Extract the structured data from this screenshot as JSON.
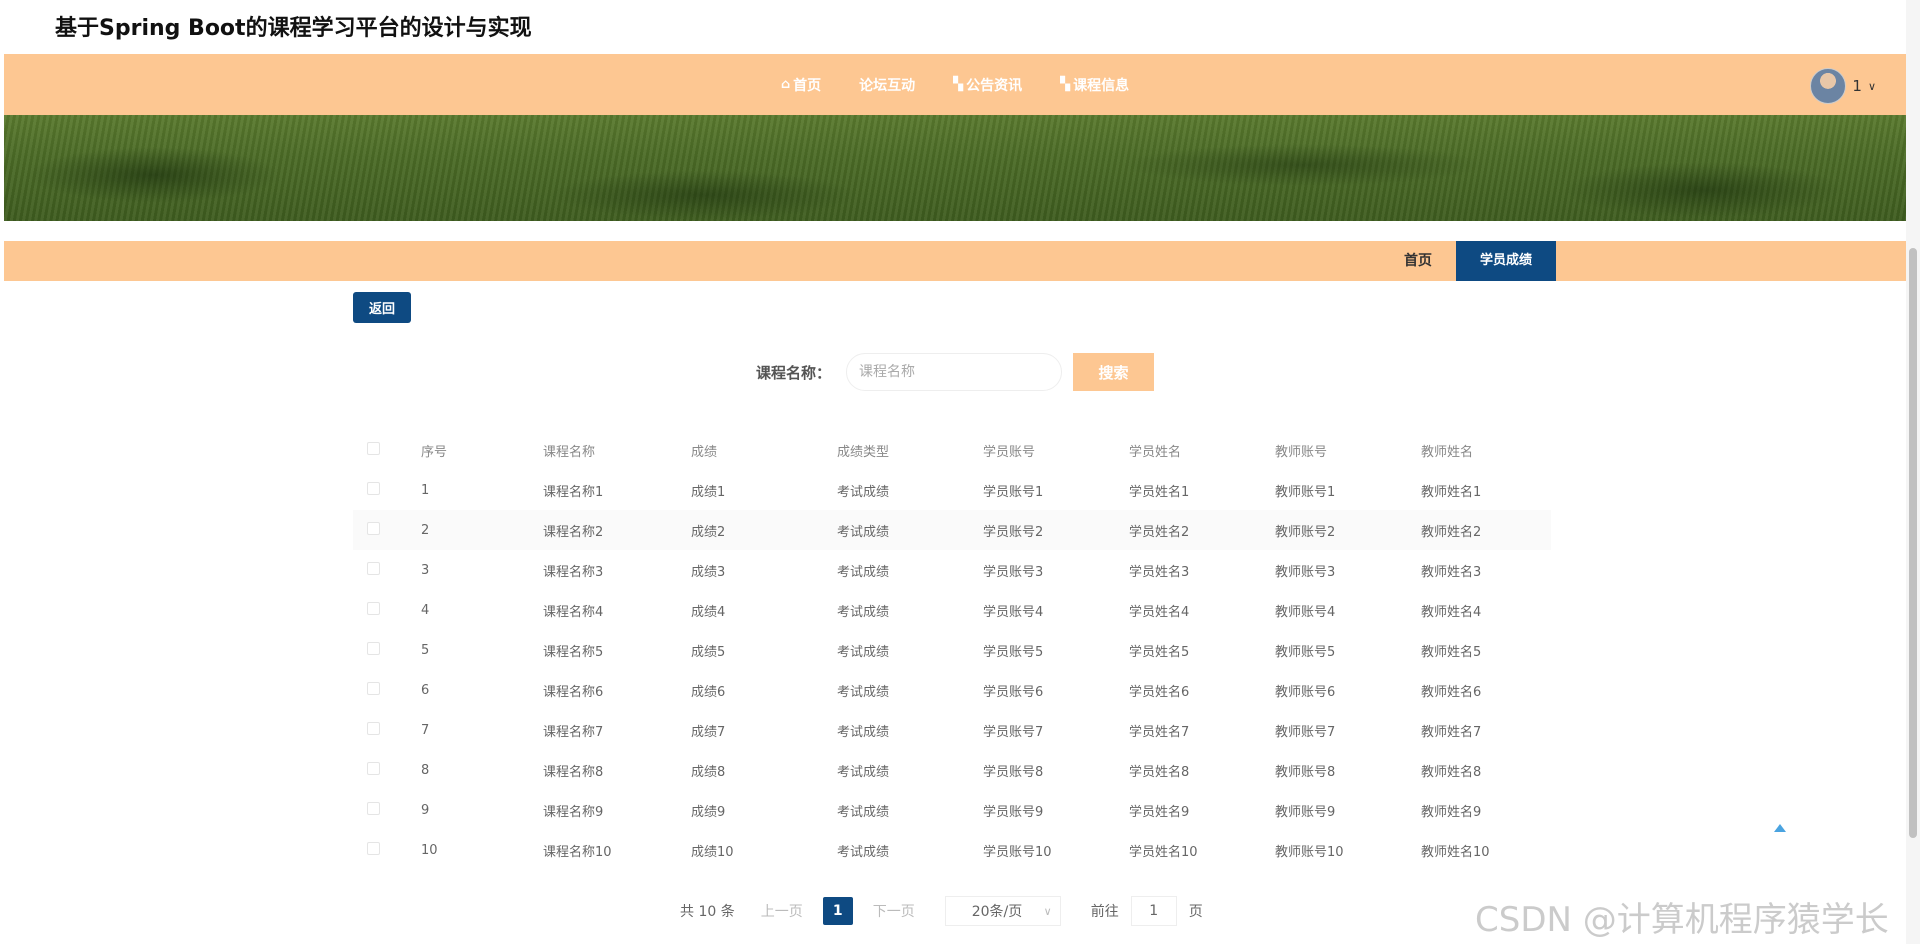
{
  "site": {
    "title": "基于Spring Boot的课程学习平台的设计与实现"
  },
  "nav": {
    "items": [
      {
        "label": "首页",
        "icon": "home-icon"
      },
      {
        "label": "论坛互动",
        "icon": ""
      },
      {
        "label": "公告资讯",
        "icon": "grid-icon"
      },
      {
        "label": "课程信息",
        "icon": "grid-icon"
      }
    ],
    "user": {
      "name": "1"
    }
  },
  "breadcrumb": {
    "home": "首页",
    "current": "学员成绩"
  },
  "actions": {
    "back_label": "返回"
  },
  "search": {
    "label": "课程名称：",
    "placeholder": "课程名称",
    "button_label": "搜索"
  },
  "table": {
    "headers": [
      "序号",
      "课程名称",
      "成绩",
      "成绩类型",
      "学员账号",
      "学员姓名",
      "教师账号",
      "教师姓名"
    ],
    "rows": [
      [
        "1",
        "课程名称1",
        "成绩1",
        "考试成绩",
        "学员账号1",
        "学员姓名1",
        "教师账号1",
        "教师姓名1"
      ],
      [
        "2",
        "课程名称2",
        "成绩2",
        "考试成绩",
        "学员账号2",
        "学员姓名2",
        "教师账号2",
        "教师姓名2"
      ],
      [
        "3",
        "课程名称3",
        "成绩3",
        "考试成绩",
        "学员账号3",
        "学员姓名3",
        "教师账号3",
        "教师姓名3"
      ],
      [
        "4",
        "课程名称4",
        "成绩4",
        "考试成绩",
        "学员账号4",
        "学员姓名4",
        "教师账号4",
        "教师姓名4"
      ],
      [
        "5",
        "课程名称5",
        "成绩5",
        "考试成绩",
        "学员账号5",
        "学员姓名5",
        "教师账号5",
        "教师姓名5"
      ],
      [
        "6",
        "课程名称6",
        "成绩6",
        "考试成绩",
        "学员账号6",
        "学员姓名6",
        "教师账号6",
        "教师姓名6"
      ],
      [
        "7",
        "课程名称7",
        "成绩7",
        "考试成绩",
        "学员账号7",
        "学员姓名7",
        "教师账号7",
        "教师姓名7"
      ],
      [
        "8",
        "课程名称8",
        "成绩8",
        "考试成绩",
        "学员账号8",
        "学员姓名8",
        "教师账号8",
        "教师姓名8"
      ],
      [
        "9",
        "课程名称9",
        "成绩9",
        "考试成绩",
        "学员账号9",
        "学员姓名9",
        "教师账号9",
        "教师姓名9"
      ],
      [
        "10",
        "课程名称10",
        "成绩10",
        "考试成绩",
        "学员账号10",
        "学员姓名10",
        "教师账号10",
        "教师姓名10"
      ]
    ]
  },
  "pagination": {
    "total": "共 10 条",
    "prev": "上一页",
    "current": "1",
    "next": "下一页",
    "page_size": "20条/页",
    "goto_label": "前往",
    "goto_value": "1",
    "page_unit": "页"
  },
  "watermark": "CSDN @计算机程序猿学长",
  "colors": {
    "accent": "#fdc792",
    "primary": "#0e4a82",
    "back_top": "#4aa3e0"
  }
}
